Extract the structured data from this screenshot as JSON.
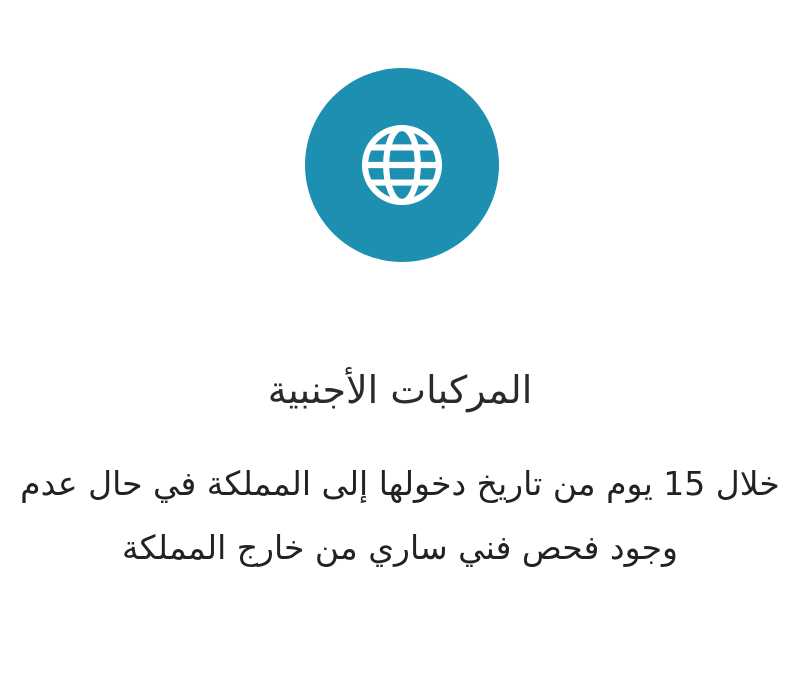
{
  "icon": {
    "name": "globe-icon",
    "background_color": "#1d8fb0",
    "glyph_color": "#ffffff"
  },
  "content": {
    "title": "المركبات الأجنبية",
    "description": "خلال 15 يوم من تاريخ دخولها إلى المملكة في حال عدم وجود فحص فني ساري من خارج المملكة"
  },
  "colors": {
    "accent": "#1d8fb0",
    "text": "#222222",
    "background": "#ffffff"
  }
}
